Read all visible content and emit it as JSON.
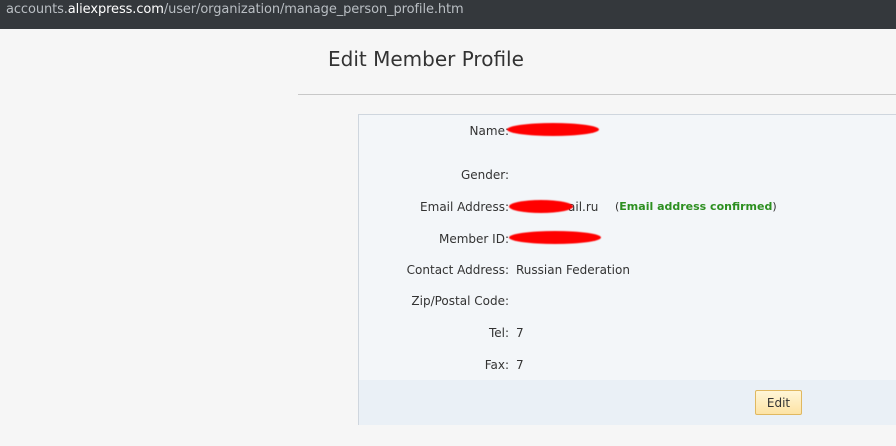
{
  "browser": {
    "url_prefix": "accounts.",
    "url_host": "aliexpress.com",
    "url_path": "/user/organization/manage_person_profile.htm"
  },
  "page": {
    "title": "Edit Member Profile"
  },
  "profile": {
    "name_label": "Name:",
    "gender_label": "Gender:",
    "email_label": "Email Address:",
    "email_visible_fragment": "ail.ru",
    "email_status_open": "(",
    "email_status": "Email address confirmed",
    "email_status_close": ")",
    "member_id_label": "Member ID:",
    "contact_address_label": "Contact Address:",
    "contact_address_value": "Russian Federation",
    "zip_label": "Zip/Postal Code:",
    "tel_label": "Tel:",
    "tel_value": "7",
    "fax_label": "Fax:",
    "fax_value": "7",
    "edit_button_label": "Edit"
  },
  "colors": {
    "url_bar_bg": "#34383c",
    "panel_bg": "#f3f6f9",
    "confirmed_green": "#2c8f20",
    "redaction_red": "#ff0000",
    "edit_button_bg": "#fde3a4"
  }
}
